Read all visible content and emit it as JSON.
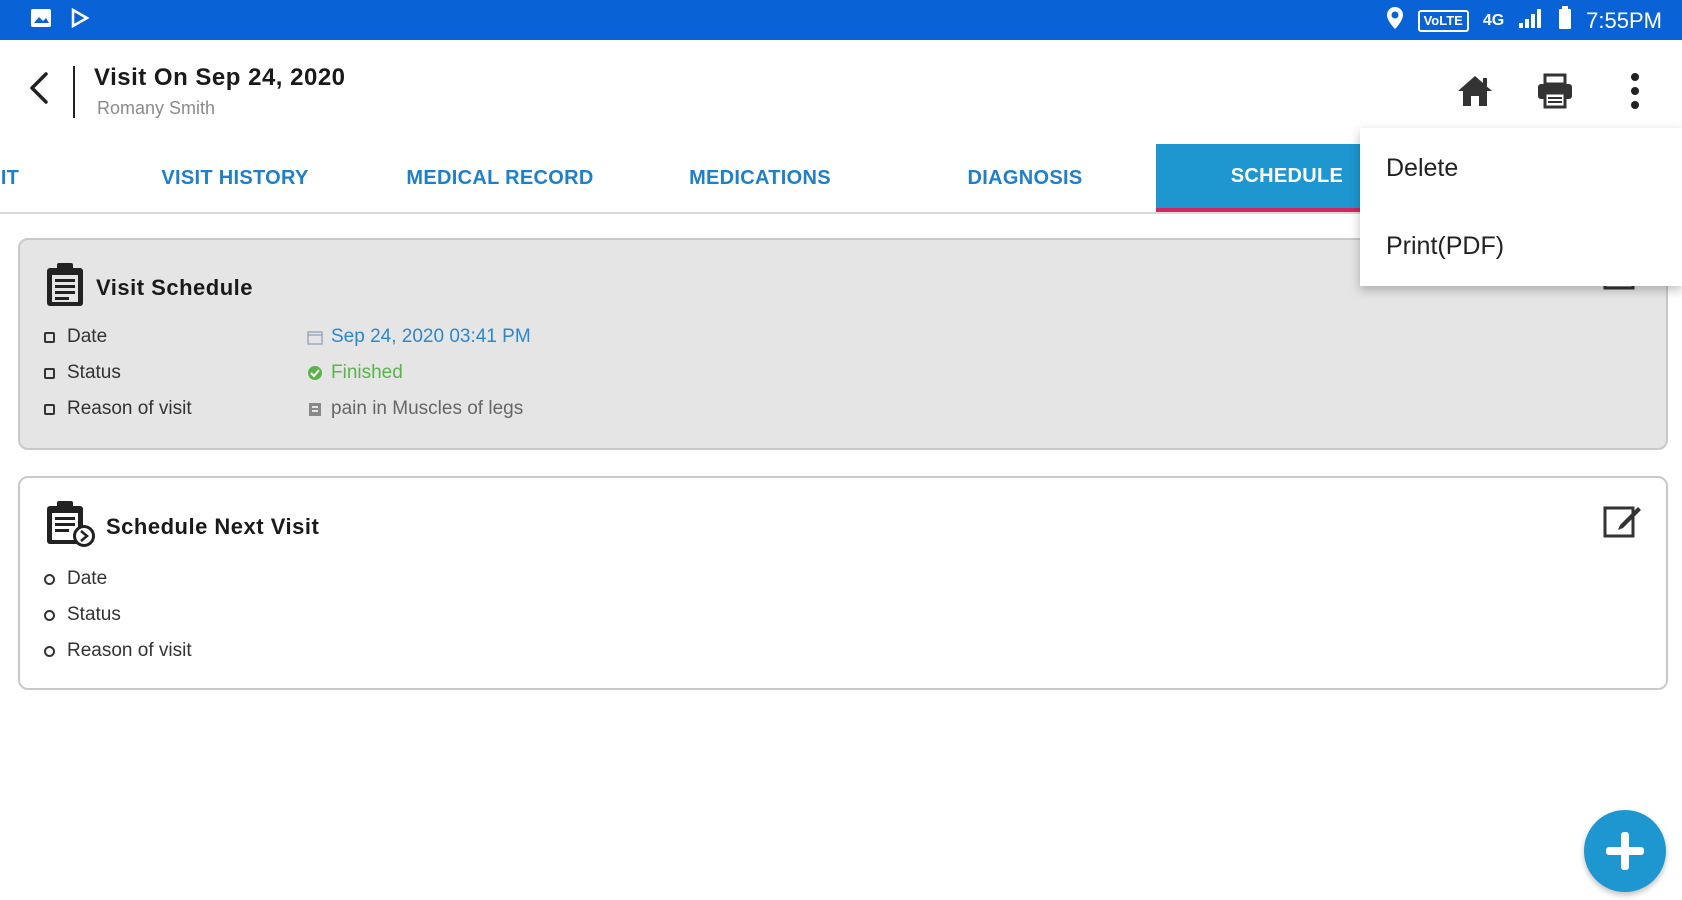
{
  "status_bar": {
    "network_tag": "VoLTE",
    "network_type": "4G",
    "time": "7:55PM"
  },
  "app_bar": {
    "title": "Visit On Sep 24, 2020",
    "subtitle": "Romany Smith"
  },
  "tabs": [
    {
      "label": "IT"
    },
    {
      "label": "VISIT HISTORY"
    },
    {
      "label": "MEDICAL RECORD"
    },
    {
      "label": "MEDICATIONS"
    },
    {
      "label": "DIAGNOSIS"
    },
    {
      "label": "SCHEDULE",
      "active": true
    }
  ],
  "menu": {
    "items": [
      {
        "label": "Delete"
      },
      {
        "label": "Print(PDF)"
      }
    ]
  },
  "visit_schedule": {
    "title": "Visit Schedule",
    "rows": [
      {
        "label": "Date",
        "value": "Sep 24, 2020 03:41 PM"
      },
      {
        "label": "Status",
        "value": "Finished"
      },
      {
        "label": "Reason of visit",
        "value": "pain in Muscles of legs"
      }
    ]
  },
  "next_visit": {
    "title": "Schedule Next Visit",
    "rows": [
      {
        "label": "Date"
      },
      {
        "label": "Status"
      },
      {
        "label": "Reason of visit"
      }
    ]
  },
  "colors": {
    "status_bar": "#0a63d6",
    "accent": "#1e96d0",
    "tab_text": "#1f7fc8",
    "active_indicator": "#d6245e",
    "status_finished": "#58b44a"
  }
}
